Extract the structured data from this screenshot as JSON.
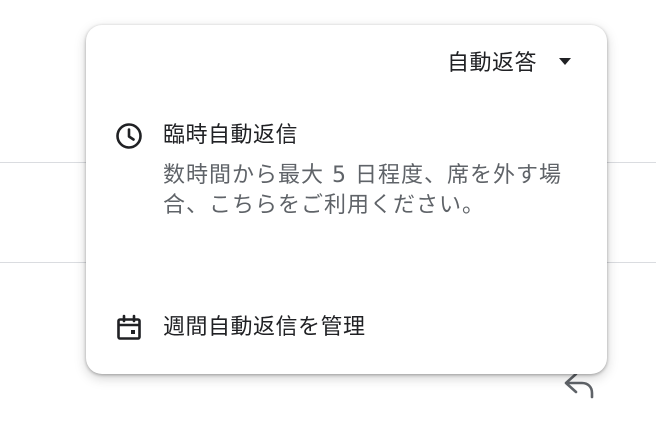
{
  "menu": {
    "header_label": "自動返答",
    "icons": {
      "header_arrow": "chevron-down-icon",
      "temporary": "clock-icon",
      "manage": "calendar-icon",
      "background": "reply-icon"
    },
    "temporary_auto_reply": {
      "title": "臨時自動返信",
      "description": "数時間から最大 5 日程度、席を外す場合、こちらをご利用ください。"
    },
    "manage_weekly": {
      "title": "週間自動返信を管理"
    }
  },
  "colors": {
    "text_primary": "#202124",
    "text_secondary": "#5f6368",
    "divider": "#dadce0",
    "surface": "#ffffff"
  }
}
